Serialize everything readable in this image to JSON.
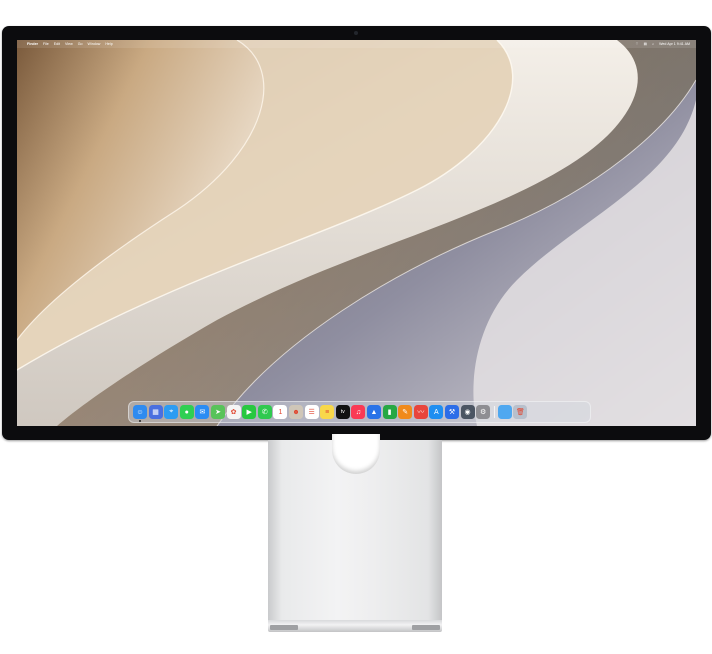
{
  "menubar": {
    "app_name": "Finder",
    "menus": [
      "File",
      "Edit",
      "View",
      "Go",
      "Window",
      "Help"
    ],
    "status_icons": [
      "wifi-icon",
      "control-center-icon",
      "search-icon"
    ],
    "clock": "Wed Apr 1 9:41 AM"
  },
  "dock": {
    "apps": [
      {
        "name": "Finder",
        "icon": "finder-icon",
        "color": "#2f8bf0",
        "glyph": "☺"
      },
      {
        "name": "Launchpad",
        "icon": "launchpad-icon",
        "color": "#4a6fe0",
        "glyph": "▦"
      },
      {
        "name": "Safari",
        "icon": "safari-icon",
        "color": "#2d9cf2",
        "glyph": "⌖"
      },
      {
        "name": "Messages",
        "icon": "messages-icon",
        "color": "#2fcf52",
        "glyph": "●"
      },
      {
        "name": "Mail",
        "icon": "mail-icon",
        "color": "#2a8cf3",
        "glyph": "✉"
      },
      {
        "name": "Maps",
        "icon": "maps-icon",
        "color": "#58c35a",
        "glyph": "➤"
      },
      {
        "name": "Photos",
        "icon": "photos-icon",
        "color": "#f5f5f5",
        "glyph": "✿"
      },
      {
        "name": "FaceTime",
        "icon": "facetime-icon",
        "color": "#28c840",
        "glyph": "▶"
      },
      {
        "name": "Phone",
        "icon": "phone-icon",
        "color": "#2fc94f",
        "glyph": "✆"
      },
      {
        "name": "Calendar",
        "icon": "calendar-icon",
        "color": "#ffffff",
        "glyph": "1"
      },
      {
        "name": "Contacts",
        "icon": "contacts-icon",
        "color": "#cfc6b8",
        "glyph": "☻"
      },
      {
        "name": "Reminders",
        "icon": "reminders-icon",
        "color": "#ffffff",
        "glyph": "☰"
      },
      {
        "name": "Notes",
        "icon": "notes-icon",
        "color": "#f8d84a",
        "glyph": "≡"
      },
      {
        "name": "TV",
        "icon": "tv-icon",
        "color": "#111111",
        "glyph": "tv"
      },
      {
        "name": "Music",
        "icon": "music-icon",
        "color": "#fa3a55",
        "glyph": "♫"
      },
      {
        "name": "Keynote",
        "icon": "keynote-icon",
        "color": "#2a73e8",
        "glyph": "▲"
      },
      {
        "name": "Numbers",
        "icon": "numbers-icon",
        "color": "#27a844",
        "glyph": "▮"
      },
      {
        "name": "Pages",
        "icon": "pages-icon",
        "color": "#f08a1c",
        "glyph": "✎"
      },
      {
        "name": "Freeform",
        "icon": "freeform-icon",
        "color": "#e8453c",
        "glyph": "〰"
      },
      {
        "name": "App Store",
        "icon": "app-store-icon",
        "color": "#1f8ef1",
        "glyph": "A"
      },
      {
        "name": "Xcode",
        "icon": "xcode-icon",
        "color": "#2c6de8",
        "glyph": "⚒"
      },
      {
        "name": "Preview",
        "icon": "preview-icon",
        "color": "#4b5563",
        "glyph": "◉"
      },
      {
        "name": "System Settings",
        "icon": "settings-icon",
        "color": "#8e8e93",
        "glyph": "⚙"
      }
    ],
    "trailing": [
      {
        "name": "Downloads",
        "icon": "downloads-folder-icon",
        "color": "#4fa8f0",
        "glyph": ""
      },
      {
        "name": "Trash",
        "icon": "trash-icon",
        "color": "#b8c0cc",
        "glyph": "🗑"
      }
    ]
  }
}
